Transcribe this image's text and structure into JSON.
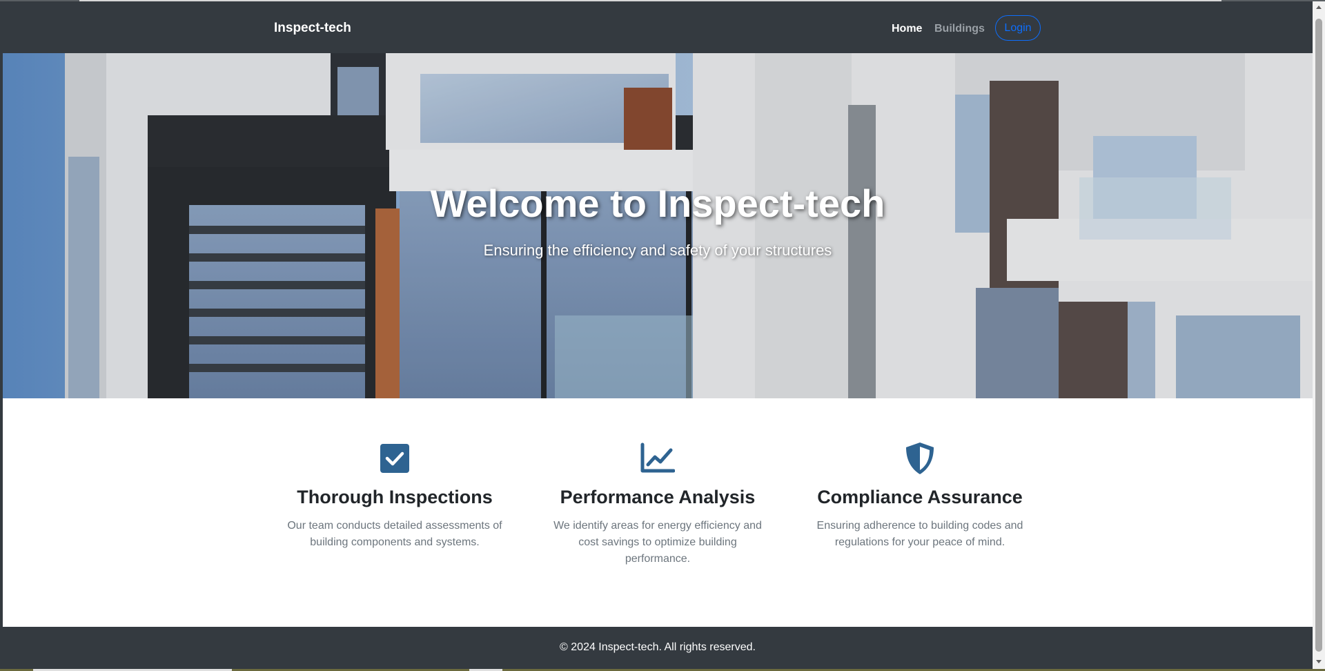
{
  "navbar": {
    "brand": "Inspect-tech",
    "links": [
      {
        "label": "Home",
        "active": true
      },
      {
        "label": "Buildings",
        "active": false
      }
    ],
    "login_label": "Login"
  },
  "hero": {
    "title": "Welcome to Inspect-tech",
    "subtitle": "Ensuring the efficiency and safety of your structures"
  },
  "features": [
    {
      "icon": "check-square-icon",
      "title": "Thorough Inspections",
      "text": "Our team conducts detailed assessments of building components and systems."
    },
    {
      "icon": "chart-line-icon",
      "title": "Performance Analysis",
      "text": "We identify areas for energy efficiency and cost savings to optimize building performance."
    },
    {
      "icon": "shield-icon",
      "title": "Compliance Assurance",
      "text": "Ensuring adherence to building codes and regulations for your peace of mind."
    }
  ],
  "footer": {
    "text": "© 2024 Inspect-tech. All rights reserved."
  },
  "colors": {
    "navbar_bg": "#343a40",
    "accent": "#0d6efd",
    "icon": "#2e6391",
    "muted_text": "#6c757d"
  }
}
